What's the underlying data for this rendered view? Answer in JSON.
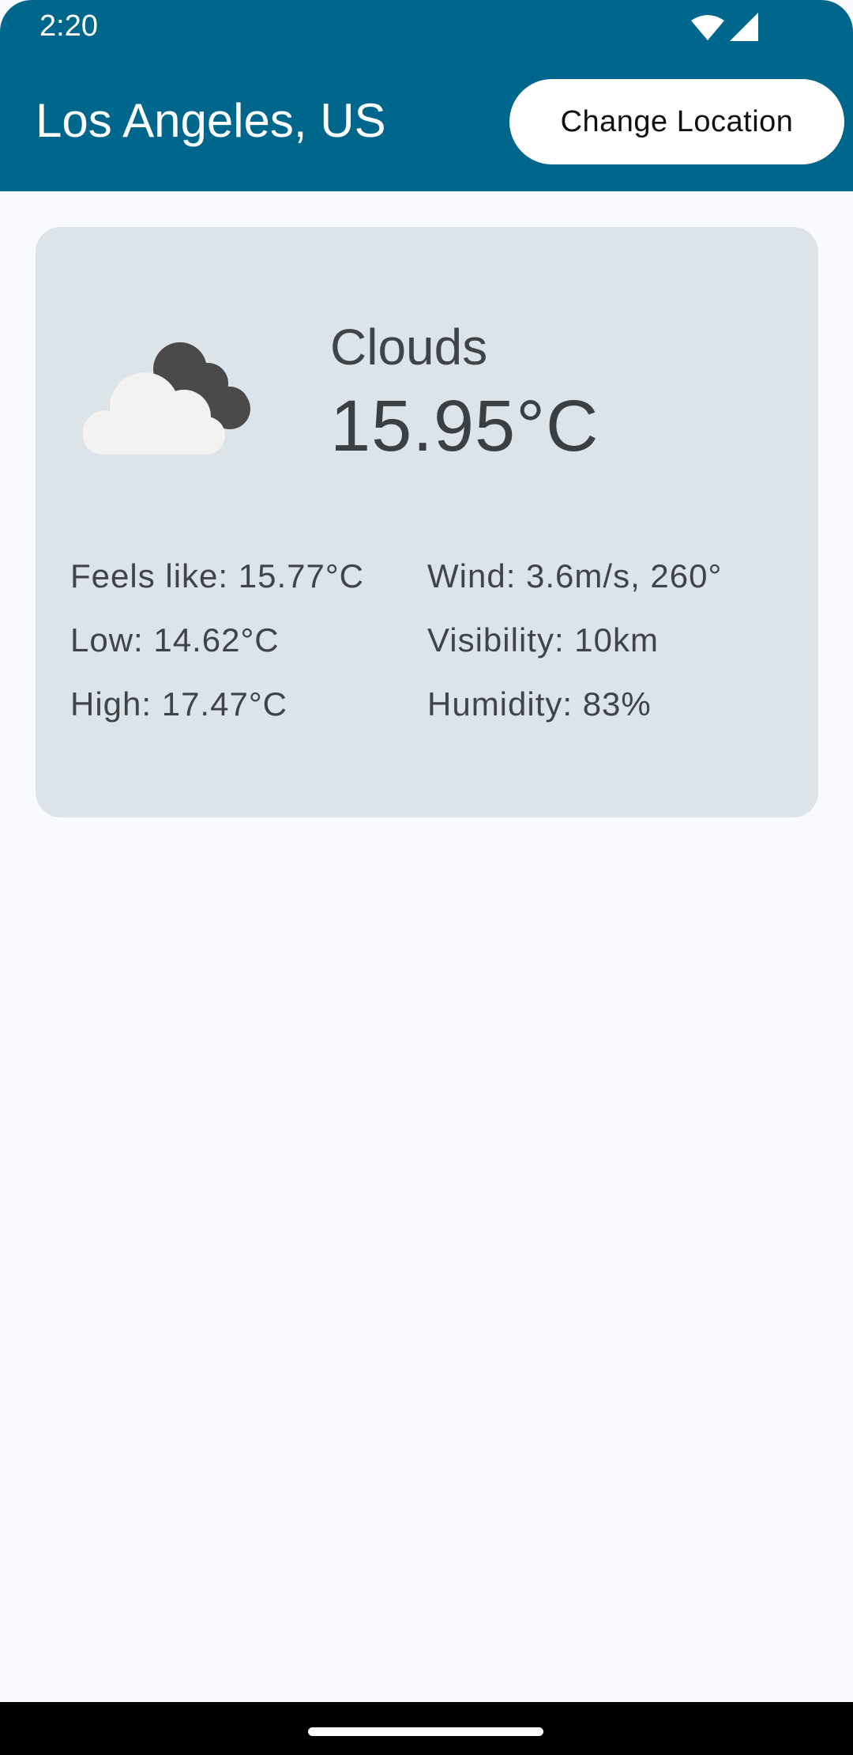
{
  "status_bar": {
    "time": "2:20",
    "icons": [
      "wifi-icon",
      "cell-signal-icon"
    ]
  },
  "header": {
    "location": "Los Angeles, US",
    "change_location_label": "Change Location",
    "background_color": "#00668b"
  },
  "weather": {
    "icon": "clouds-icon",
    "condition": "Clouds",
    "temperature": "15.95°C",
    "details": {
      "feels_like": "Feels like: 15.77°C",
      "low": "Low: 14.62°C",
      "high": "High: 17.47°C",
      "wind": "Wind: 3.6m/s, 260°",
      "visibility": "Visibility: 10km",
      "humidity": "Humidity: 83%"
    }
  },
  "colors": {
    "card_background": "#dce3e9",
    "page_background": "#f9fafd"
  }
}
